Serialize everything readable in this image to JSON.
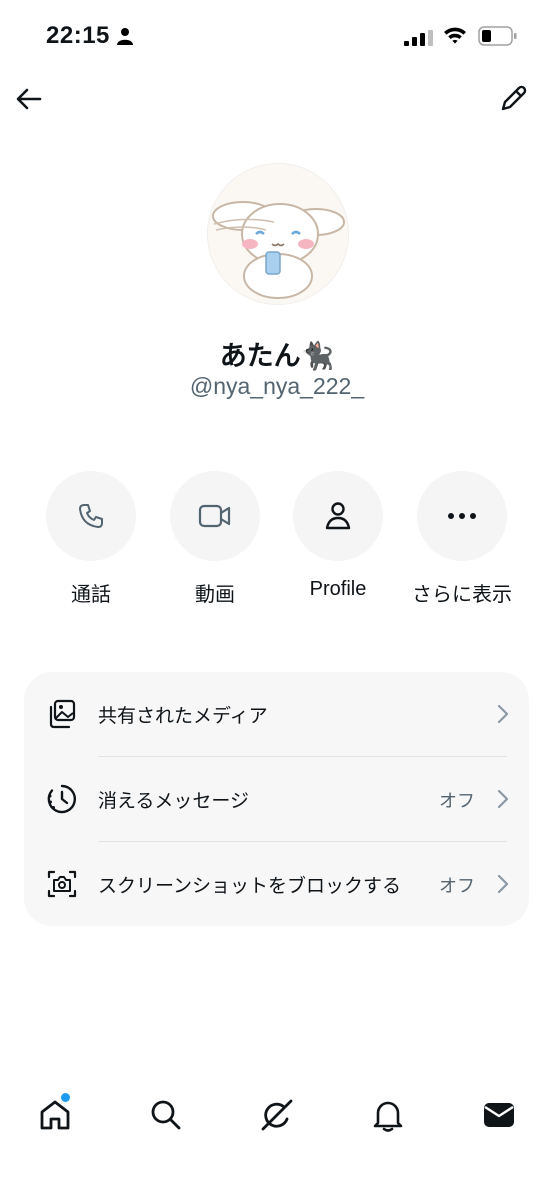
{
  "status_bar": {
    "time": "22:15"
  },
  "profile": {
    "name": "あたん🐈‍⬛",
    "handle": "@nya_nya_222_"
  },
  "actions": [
    {
      "label": "通話",
      "icon": "phone-icon"
    },
    {
      "label": "動画",
      "icon": "video-icon"
    },
    {
      "label": "Profile",
      "icon": "person-icon"
    },
    {
      "label": "さらに表示",
      "icon": "more-icon"
    }
  ],
  "settings": {
    "shared_media": {
      "label": "共有されたメディア",
      "icon": "media-icon"
    },
    "disappearing": {
      "label": "消えるメッセージ",
      "value": "オフ",
      "icon": "timer-icon"
    },
    "screenshot_block": {
      "label": "スクリーンショットをブロックする",
      "value": "オフ",
      "icon": "camera-block-icon"
    }
  },
  "tab_bar": {
    "items": [
      "home-icon",
      "search-icon",
      "grok-icon",
      "notifications-icon",
      "messages-icon"
    ],
    "home_has_dot": true,
    "accent_color": "#1d9bf0"
  }
}
